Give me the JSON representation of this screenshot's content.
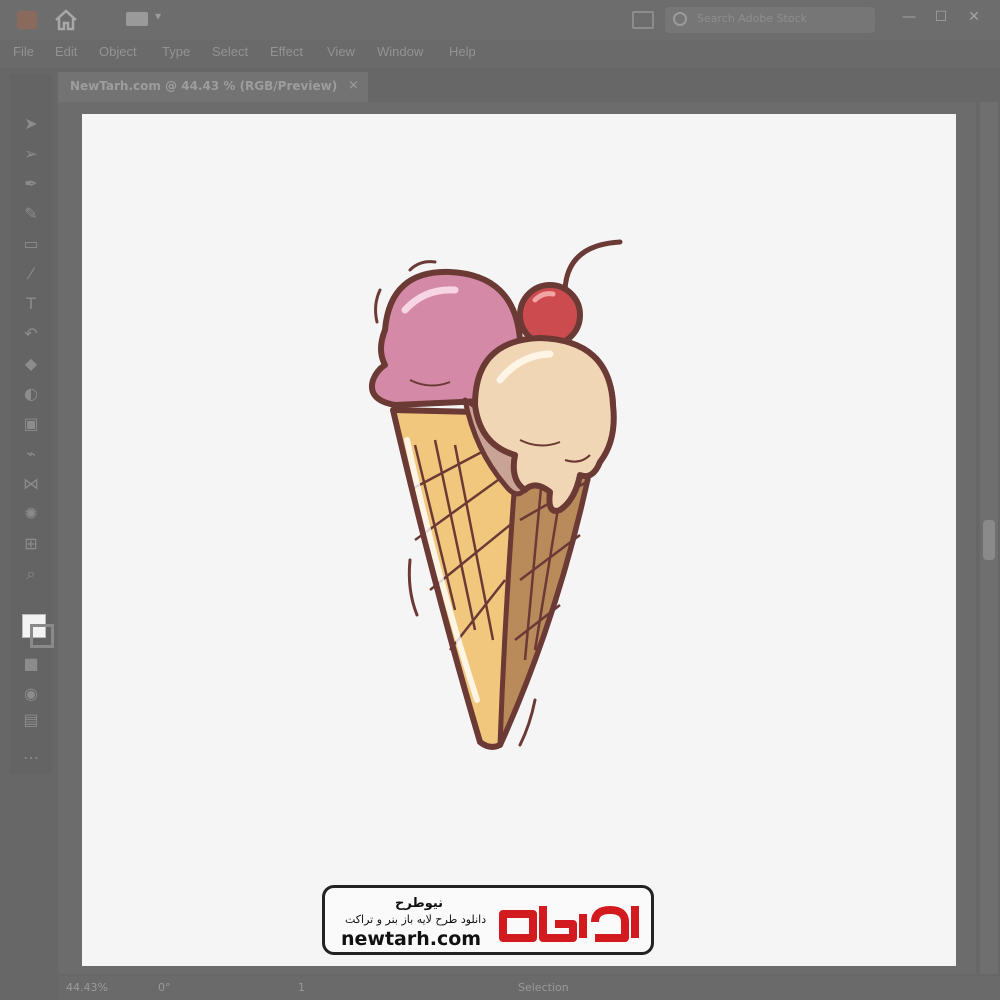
{
  "window": {
    "search_placeholder": "Search Adobe Stock",
    "minimize": "—",
    "maximize": "☐",
    "close": "✕"
  },
  "menu": [
    "File",
    "Edit",
    "Object",
    "Type",
    "Select",
    "Effect",
    "View",
    "Window",
    "Help"
  ],
  "document_tab": {
    "label": "NewTarh.com @ 44.43 % (RGB/Preview)",
    "close": "×"
  },
  "status": {
    "zoom": "44.43%",
    "rotation": "0°",
    "artboard": "1",
    "tool": "Selection"
  },
  "watermark": {
    "title_fa": "نیوطرح",
    "subtitle_fa": "دانلود طرح لایه باز بنر و تراکت",
    "url": "newtarh.com",
    "logo_text": "نیوطرح"
  },
  "colors": {
    "artboard": "#f5f5f6",
    "outline": "#6b3a35",
    "scoop_pink": "#d48aa6",
    "scoop_vanilla": "#f0d6b4",
    "cherry": "#cc4b4e",
    "cone_light": "#f0c77c",
    "cone_dark": "#b98a5a",
    "logo_red": "#d21a1f"
  }
}
